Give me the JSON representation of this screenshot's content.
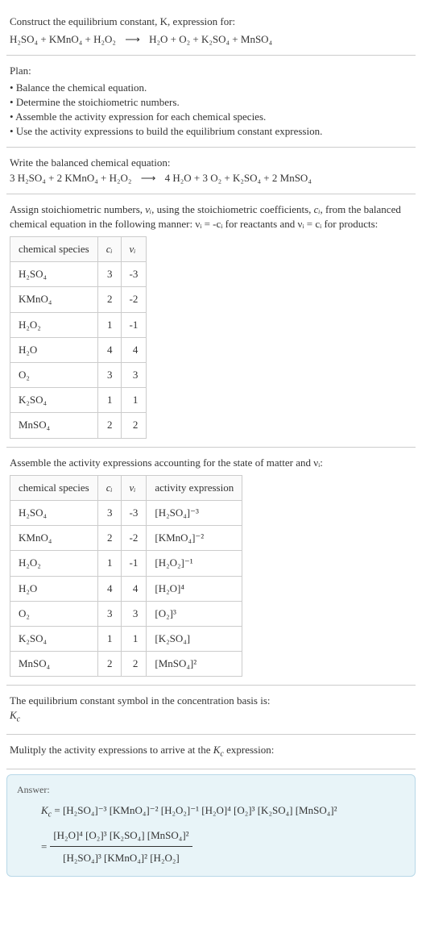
{
  "intro": {
    "line1": "Construct the equilibrium constant, K, expression for:",
    "equation_left": "H₂SO₄ + KMnO₄ + H₂O₂",
    "arrow": "⟶",
    "equation_right": "H₂O + O₂ + K₂SO₄ + MnSO₄"
  },
  "plan": {
    "title": "Plan:",
    "items": [
      "Balance the chemical equation.",
      "Determine the stoichiometric numbers.",
      "Assemble the activity expression for each chemical species.",
      "Use the activity expressions to build the equilibrium constant expression."
    ]
  },
  "balanced": {
    "title": "Write the balanced chemical equation:",
    "equation_left": "3 H₂SO₄ + 2 KMnO₄ + H₂O₂",
    "arrow": "⟶",
    "equation_right": "4 H₂O + 3 O₂ + K₂SO₄ + 2 MnSO₄"
  },
  "stoich": {
    "description_part1": "Assign stoichiometric numbers, ",
    "nu_i": "νᵢ",
    "description_part2": ", using the stoichiometric coefficients, ",
    "c_i": "cᵢ",
    "description_part3": ", from the balanced chemical equation in the following manner: νᵢ = -cᵢ for reactants and νᵢ = cᵢ for products:",
    "headers": {
      "species": "chemical species",
      "ci": "cᵢ",
      "vi": "νᵢ"
    },
    "rows": [
      {
        "species": "H₂SO₄",
        "ci": "3",
        "vi": "-3"
      },
      {
        "species": "KMnO₄",
        "ci": "2",
        "vi": "-2"
      },
      {
        "species": "H₂O₂",
        "ci": "1",
        "vi": "-1"
      },
      {
        "species": "H₂O",
        "ci": "4",
        "vi": "4"
      },
      {
        "species": "O₂",
        "ci": "3",
        "vi": "3"
      },
      {
        "species": "K₂SO₄",
        "ci": "1",
        "vi": "1"
      },
      {
        "species": "MnSO₄",
        "ci": "2",
        "vi": "2"
      }
    ]
  },
  "activity": {
    "description": "Assemble the activity expressions accounting for the state of matter and νᵢ:",
    "headers": {
      "species": "chemical species",
      "ci": "cᵢ",
      "vi": "νᵢ",
      "expr": "activity expression"
    },
    "rows": [
      {
        "species": "H₂SO₄",
        "ci": "3",
        "vi": "-3",
        "expr": "[H₂SO₄]⁻³"
      },
      {
        "species": "KMnO₄",
        "ci": "2",
        "vi": "-2",
        "expr": "[KMnO₄]⁻²"
      },
      {
        "species": "H₂O₂",
        "ci": "1",
        "vi": "-1",
        "expr": "[H₂O₂]⁻¹"
      },
      {
        "species": "H₂O",
        "ci": "4",
        "vi": "4",
        "expr": "[H₂O]⁴"
      },
      {
        "species": "O₂",
        "ci": "3",
        "vi": "3",
        "expr": "[O₂]³"
      },
      {
        "species": "K₂SO₄",
        "ci": "1",
        "vi": "1",
        "expr": "[K₂SO₄]"
      },
      {
        "species": "MnSO₄",
        "ci": "2",
        "vi": "2",
        "expr": "[MnSO₄]²"
      }
    ]
  },
  "kc_symbol": {
    "line1": "The equilibrium constant symbol in the concentration basis is:",
    "symbol": "K_c"
  },
  "multiply": {
    "text": "Mulitply the activity expressions to arrive at the K_c expression:"
  },
  "answer": {
    "label": "Answer:",
    "line1_lhs": "K_c = ",
    "line1_expr": "[H₂SO₄]⁻³ [KMnO₄]⁻² [H₂O₂]⁻¹ [H₂O]⁴ [O₂]³ [K₂SO₄] [MnSO₄]²",
    "line2_eq": "= ",
    "numerator": "[H₂O]⁴ [O₂]³ [K₂SO₄] [MnSO₄]²",
    "denominator": "[H₂SO₄]³ [KMnO₄]² [H₂O₂]"
  }
}
